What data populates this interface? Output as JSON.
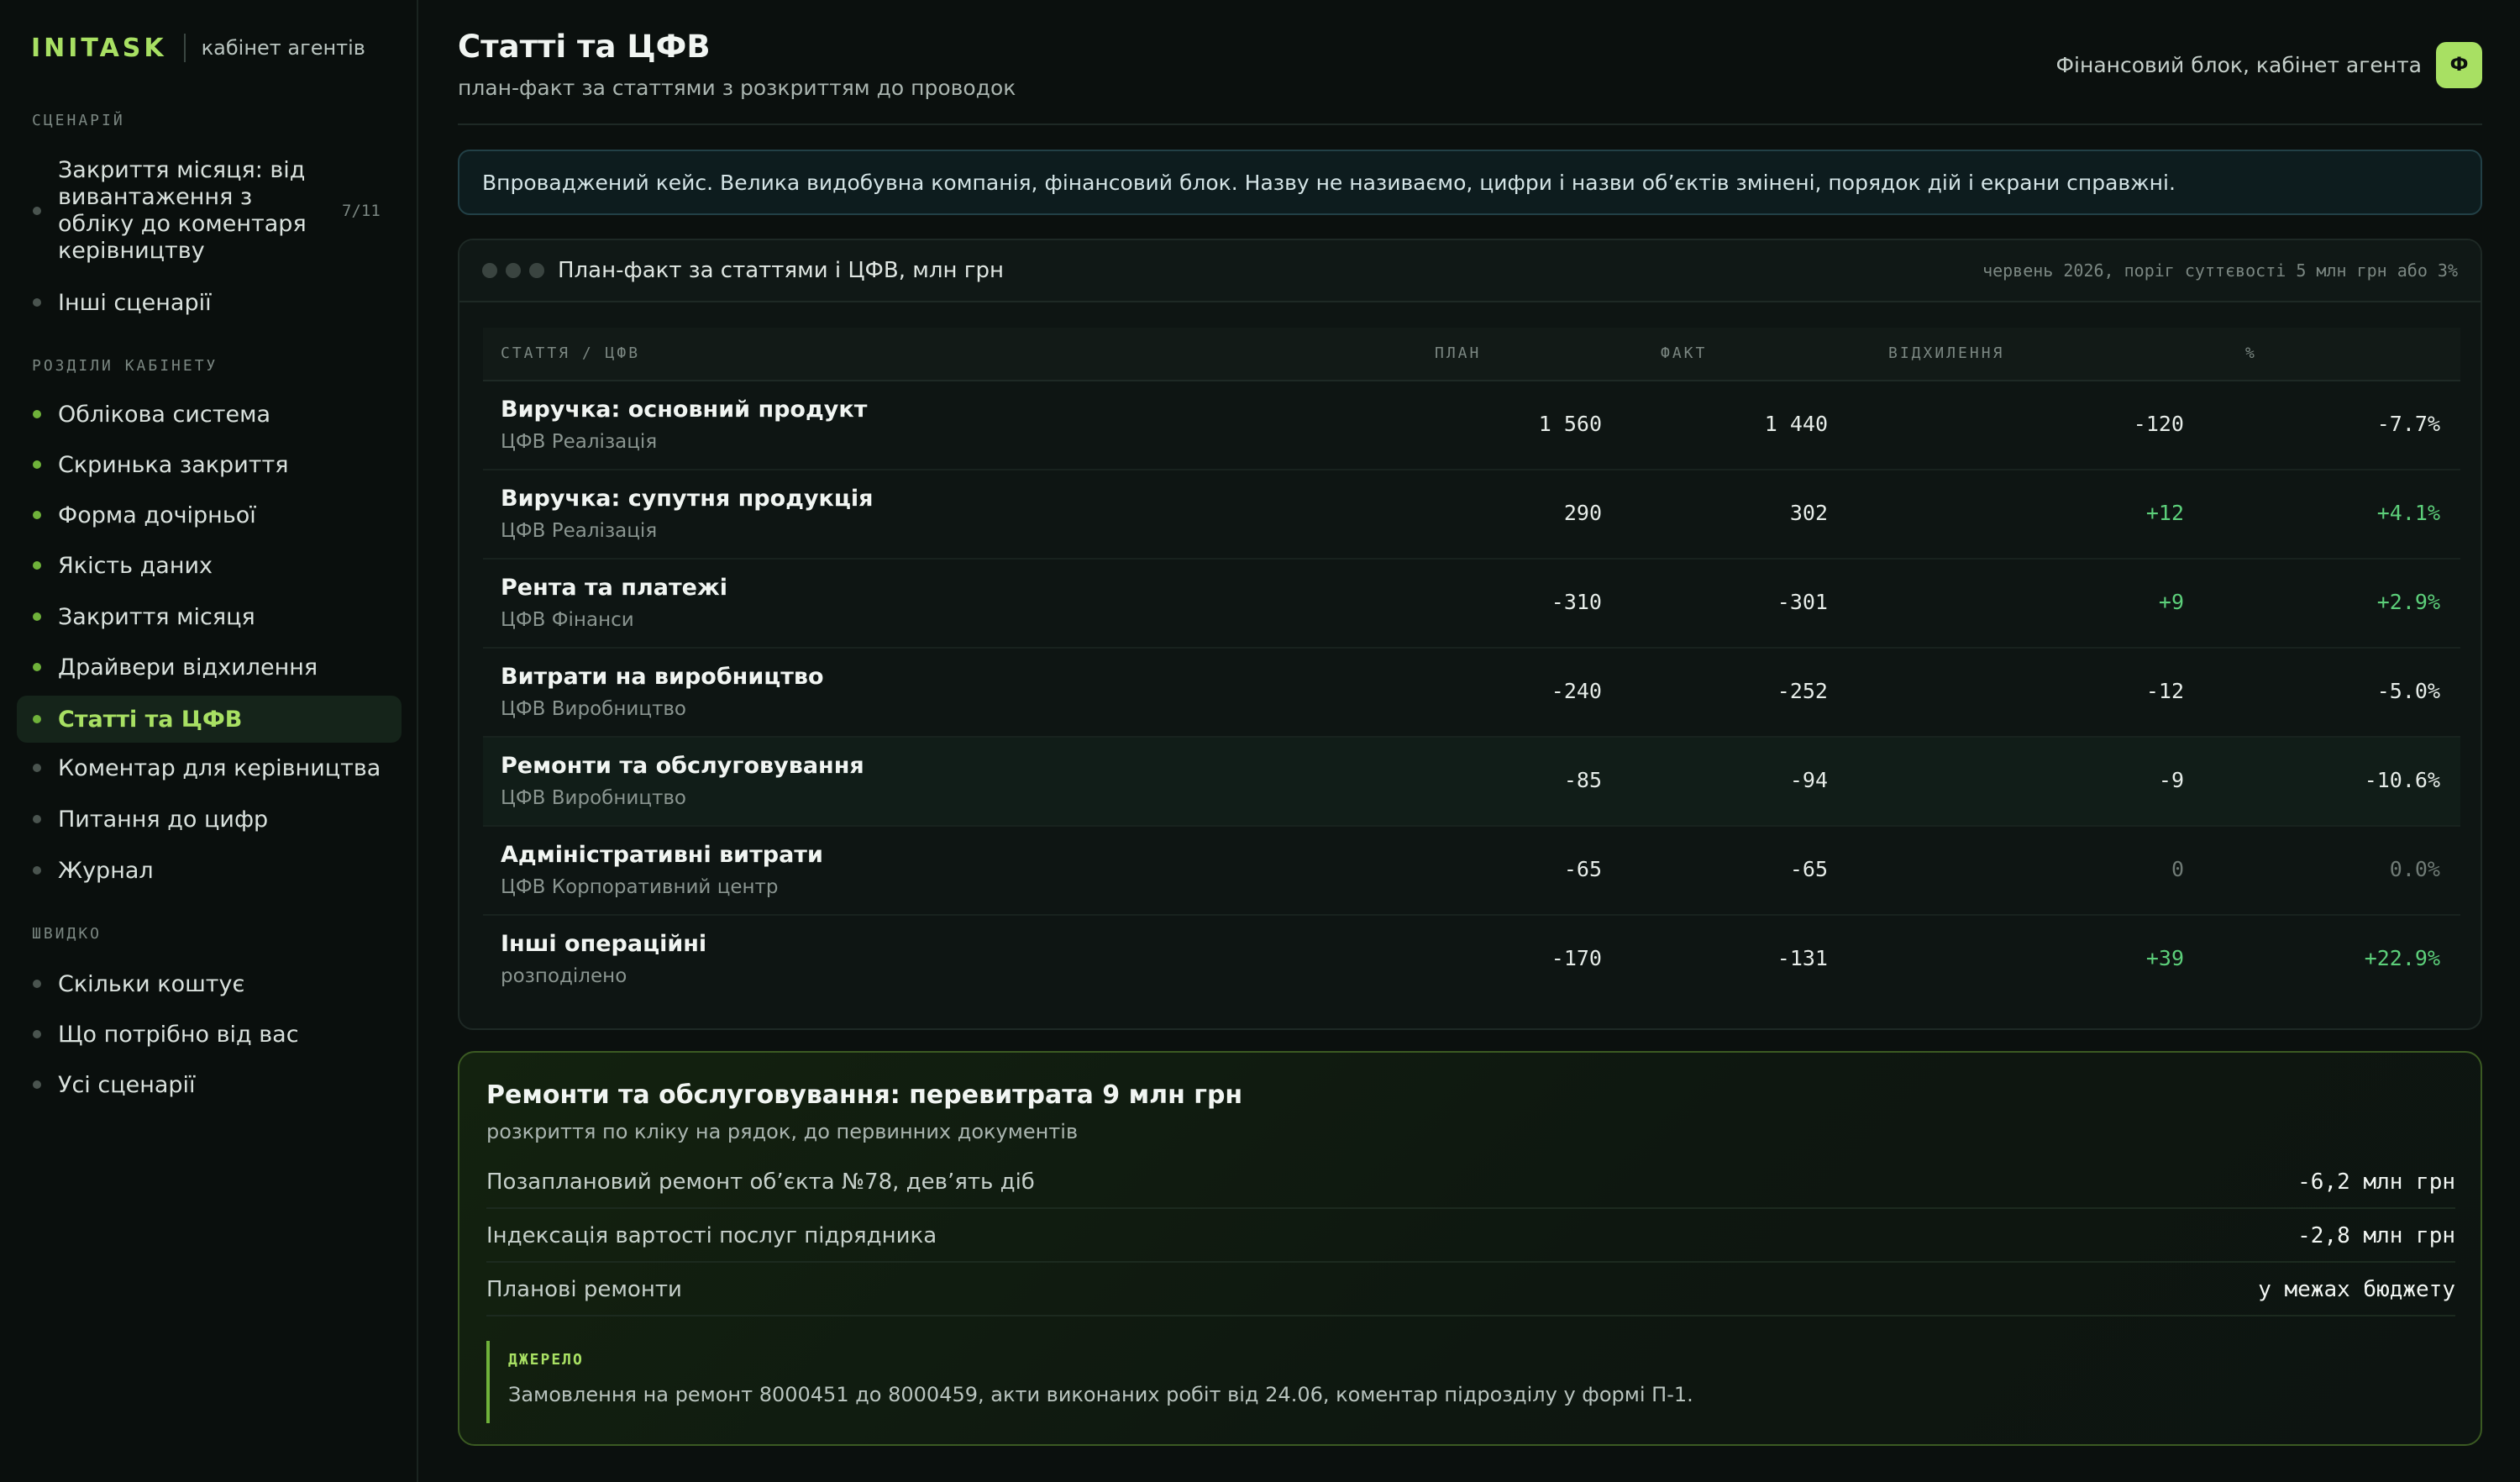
{
  "brand": {
    "name": "INITASK",
    "subtitle": "кабінет агентів"
  },
  "sidebar": {
    "scenarios_title": "СЦЕНАРІЙ",
    "scenarios": [
      {
        "label": "Закриття місяця: від вивантаження з обліку до коментаря керівництву",
        "counter": "7/11"
      },
      {
        "label": "Інші сценарії"
      }
    ],
    "sections_title": "РОЗДІЛИ КАБІНЕТУ",
    "sections": [
      {
        "label": "Облікова система"
      },
      {
        "label": "Скринька закриття"
      },
      {
        "label": "Форма дочірньої"
      },
      {
        "label": "Якість даних"
      },
      {
        "label": "Закриття місяця"
      },
      {
        "label": "Драйвери відхилення"
      },
      {
        "label": "Статті та ЦФВ"
      },
      {
        "label": "Коментар для керівництва"
      },
      {
        "label": "Питання до цифр"
      },
      {
        "label": "Журнал"
      }
    ],
    "quick_title": "ШВИДКО",
    "quick": [
      {
        "label": "Скільки коштує"
      },
      {
        "label": "Що потрібно від вас"
      },
      {
        "label": "Усі сценарії"
      }
    ]
  },
  "header": {
    "title": "Статті та ЦФВ",
    "subtitle": "план-факт за статтями з розкриттям до проводок",
    "context": "Фінансовий блок, кабінет агента",
    "avatar": "Ф"
  },
  "notice": "Впроваджений кейс. Велика видобувна компанія, фінансовий блок. Назву не називаємо, цифри і назви об’єктів змінені, порядок дій і екрани справжні.",
  "table": {
    "title": "План-факт за статтями і ЦФВ, млн грн",
    "meta": "червень 2026, поріг суттєвості 5 млн грн або 3%",
    "columns": {
      "item": "СТАТТЯ / ЦФВ",
      "plan": "ПЛАН",
      "fact": "ФАКТ",
      "dev": "ВІДХИЛЕННЯ",
      "pct": "%"
    },
    "rows": [
      {
        "name": "Виручка: основний продукт",
        "cfv": "ЦФВ Реалізація",
        "plan": "1 560",
        "fact": "1 440",
        "dev": "-120",
        "pct": "-7.7%"
      },
      {
        "name": "Виручка: супутня продукція",
        "cfv": "ЦФВ Реалізація",
        "plan": "290",
        "fact": "302",
        "dev": "+12",
        "pct": "+4.1%"
      },
      {
        "name": "Рента та платежі",
        "cfv": "ЦФВ Фінанси",
        "plan": "-310",
        "fact": "-301",
        "dev": "+9",
        "pct": "+2.9%"
      },
      {
        "name": "Витрати на виробництво",
        "cfv": "ЦФВ Виробництво",
        "plan": "-240",
        "fact": "-252",
        "dev": "-12",
        "pct": "-5.0%"
      },
      {
        "name": "Ремонти та обслуговування",
        "cfv": "ЦФВ Виробництво",
        "plan": "-85",
        "fact": "-94",
        "dev": "-9",
        "pct": "-10.6%"
      },
      {
        "name": "Адміністративні витрати",
        "cfv": "ЦФВ Корпоративний центр",
        "plan": "-65",
        "fact": "-65",
        "dev": "0",
        "pct": "0.0%"
      },
      {
        "name": "Інші операційні",
        "cfv": "розподілено",
        "plan": "-170",
        "fact": "-131",
        "dev": "+39",
        "pct": "+22.9%"
      }
    ]
  },
  "detail": {
    "title": "Ремонти та обслуговування: перевитрата 9 млн грн",
    "subtitle": "розкриття по кліку на рядок, до первинних документів",
    "rows": [
      {
        "label": "Позаплановий ремонт об’єкта №78, дев’ять діб",
        "value": "-6,2 млн грн"
      },
      {
        "label": "Індексація вартості послуг підрядника",
        "value": "-2,8 млн грн"
      },
      {
        "label": "Планові ремонти",
        "value": "у межах бюджету"
      }
    ],
    "source_title": "ДЖЕРЕЛО",
    "source_text": "Замовлення на ремонт 8000451 до 8000459, акти виконаних робіт від 24.06, коментар підрозділу у формі П-1."
  }
}
